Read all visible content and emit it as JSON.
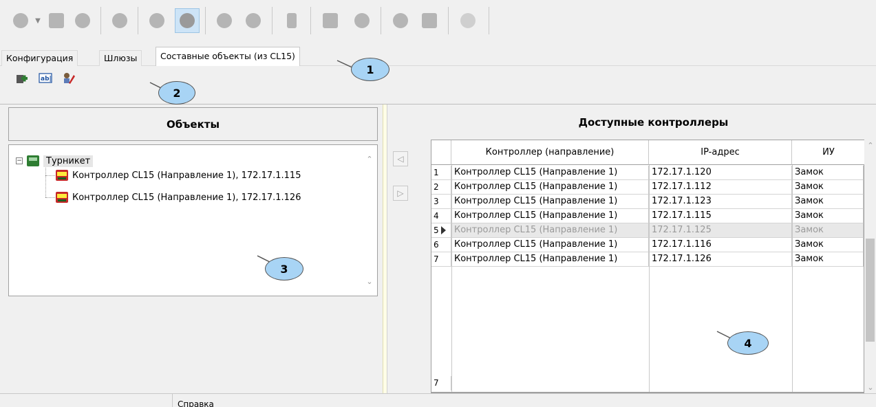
{
  "toolbar": {
    "buttons": [
      {
        "icon": "add-device-icon"
      },
      {
        "icon": "dropdown-arrow-icon"
      },
      {
        "icon": "delete-icon"
      },
      {
        "icon": "properties-icon"
      },
      {
        "icon": "users-icon"
      },
      {
        "icon": "edit-icon"
      },
      {
        "icon": "cancel-icon",
        "active": true
      },
      {
        "icon": "start-icon"
      },
      {
        "icon": "stop-icon"
      },
      {
        "icon": "alert-icon"
      },
      {
        "icon": "map-icon"
      },
      {
        "icon": "refresh-icon"
      },
      {
        "icon": "brush-icon"
      },
      {
        "icon": "info-icon"
      },
      {
        "icon": "settings-icon"
      }
    ]
  },
  "tabs": [
    {
      "label": "Конфигурация"
    },
    {
      "label": "Шлюзы"
    },
    {
      "label": "Составные объекты (из CL15)",
      "active": true
    }
  ],
  "toolbar2": {
    "buttons": [
      {
        "icon": "add-object-icon"
      },
      {
        "icon": "rename-icon"
      },
      {
        "icon": "edit-object-icon"
      }
    ]
  },
  "left": {
    "title": "Объекты",
    "tree": {
      "root": "Турникет",
      "children": [
        "Контроллер CL15 (Направление 1), 172.17.1.115",
        "Контроллер CL15 (Направление 1), 172.17.1.126"
      ]
    }
  },
  "right": {
    "title": "Доступные контроллеры",
    "columns": [
      "Контроллер (направление)",
      "IP-адрес",
      "ИУ"
    ],
    "rows": [
      {
        "n": "1",
        "controller": "Контроллер CL15 (Направление 1)",
        "ip": "172.17.1.120",
        "iu": "Замок"
      },
      {
        "n": "2",
        "controller": "Контроллер CL15 (Направление 1)",
        "ip": "172.17.1.112",
        "iu": "Замок"
      },
      {
        "n": "3",
        "controller": "Контроллер CL15 (Направление 1)",
        "ip": "172.17.1.123",
        "iu": "Замок"
      },
      {
        "n": "4",
        "controller": "Контроллер CL15 (Направление 1)",
        "ip": "172.17.1.115",
        "iu": "Замок"
      },
      {
        "n": "5",
        "controller": "Контроллер CL15 (Направление 1)",
        "ip": "172.17.1.125",
        "iu": "Замок",
        "selected": true
      },
      {
        "n": "6",
        "controller": "Контроллер CL15 (Направление 1)",
        "ip": "172.17.1.116",
        "iu": "Замок"
      },
      {
        "n": "7",
        "controller": "Контроллер CL15 (Направление 1)",
        "ip": "172.17.1.126",
        "iu": "Замок"
      }
    ],
    "footer_count": "7"
  },
  "transfer": {
    "left_arrow": "◁",
    "right_arrow": "▷"
  },
  "callouts": [
    "1",
    "2",
    "3",
    "4"
  ],
  "statusbar": {
    "text": "Справка"
  },
  "colors": {
    "callout_fill": "#a8d4f5",
    "window_bg": "#f0f0f0",
    "selected_row": "#e8e8e8"
  }
}
